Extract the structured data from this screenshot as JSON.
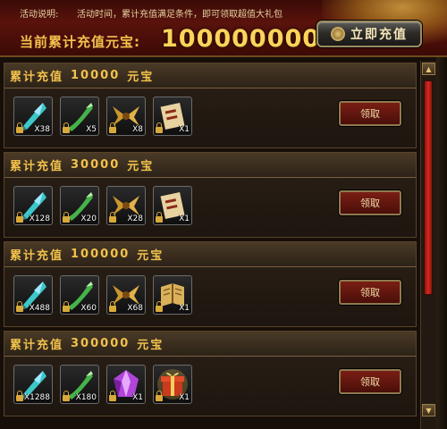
{
  "header": {
    "desc_label": "活动说明:",
    "desc_text": "活动时间，累计充值满足条件，即可领取超值大礼包",
    "current_label": "当前累计充值元宝:",
    "current_value": "100000000",
    "recharge_button": "立即充值"
  },
  "tiers": [
    {
      "prefix": "累计充值",
      "amount": "10000",
      "unit": "元宝",
      "claim": "领取",
      "items": [
        {
          "icon": "crystal-feather-icon",
          "qty": "X38"
        },
        {
          "icon": "green-horn-icon",
          "qty": "X5"
        },
        {
          "icon": "golden-wings-icon",
          "qty": "X8"
        },
        {
          "icon": "scroll-icon",
          "qty": "X1"
        }
      ]
    },
    {
      "prefix": "累计充值",
      "amount": "30000",
      "unit": "元宝",
      "claim": "领取",
      "items": [
        {
          "icon": "crystal-feather-icon",
          "qty": "X128"
        },
        {
          "icon": "green-horn-icon",
          "qty": "X20"
        },
        {
          "icon": "golden-wings-icon",
          "qty": "X28"
        },
        {
          "icon": "scroll-icon",
          "qty": "X1"
        }
      ]
    },
    {
      "prefix": "累计充值",
      "amount": "100000",
      "unit": "元宝",
      "claim": "领取",
      "items": [
        {
          "icon": "crystal-feather-icon",
          "qty": "X488"
        },
        {
          "icon": "green-horn-icon",
          "qty": "X60"
        },
        {
          "icon": "golden-wings-icon",
          "qty": "X68"
        },
        {
          "icon": "golden-book-icon",
          "qty": "X1"
        }
      ]
    },
    {
      "prefix": "累计充值",
      "amount": "300000",
      "unit": "元宝",
      "claim": "领取",
      "items": [
        {
          "icon": "crystal-feather-icon",
          "qty": "X1288"
        },
        {
          "icon": "green-horn-icon",
          "qty": "X180"
        },
        {
          "icon": "purple-gem-icon",
          "qty": "X1"
        },
        {
          "icon": "gift-box-icon",
          "qty": "X1"
        }
      ]
    }
  ],
  "colors": {
    "accent_gold": "#f2c24c",
    "value_gold": "#ffd35a",
    "claim_red": "#7a1e14",
    "scroll_red": "#d42a1e"
  }
}
